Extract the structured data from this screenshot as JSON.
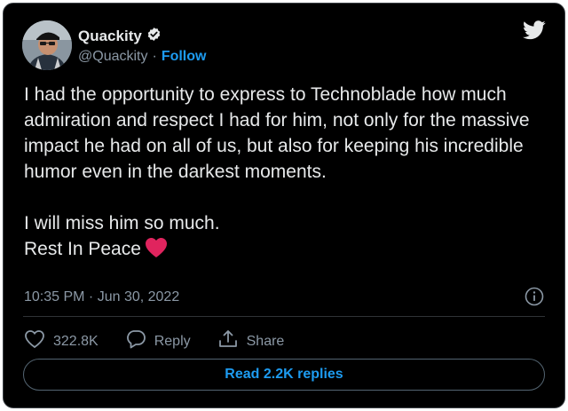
{
  "author": {
    "name": "Quackity",
    "handle": "@Quackity",
    "separator": "·",
    "follow_label": "Follow",
    "verified": true
  },
  "tweet": {
    "paragraph_1": "I had the opportunity to express to Technoblade how much admiration and respect I had for him, not only for the massive impact he had on all of us, but also for keeping his incredible humor even in the darkest moments.",
    "line_2": "I will miss him so much.",
    "line_3": "Rest In Peace",
    "emoji": "red-heart",
    "timestamp": "10:35 PM · Jun 30, 2022"
  },
  "actions": {
    "like_count": "322.8K",
    "reply_label": "Reply",
    "share_label": "Share"
  },
  "read_replies_label": "Read 2.2K replies",
  "icons": [
    "verified-badge-icon",
    "twitter-bird-icon",
    "info-icon",
    "heart-icon",
    "reply-icon",
    "share-icon"
  ],
  "colors": {
    "background": "#000000",
    "text": "#e7e9ea",
    "muted": "#8b98a5",
    "accent": "#1d9bf0",
    "heart": "#e0245e"
  }
}
